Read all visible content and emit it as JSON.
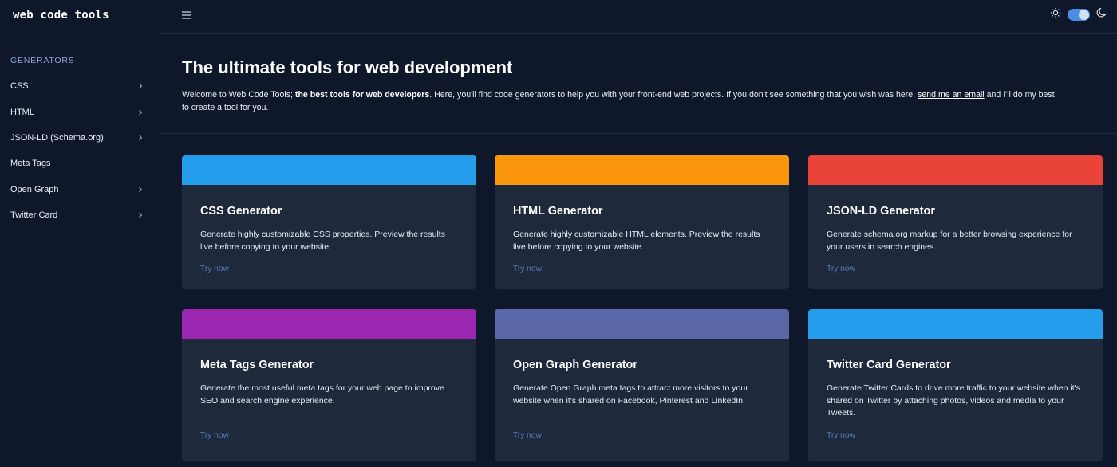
{
  "sidebar": {
    "logo": "web code tools",
    "heading": "Generators",
    "items": [
      {
        "label": "CSS",
        "has_chevron": true
      },
      {
        "label": "HTML",
        "has_chevron": true
      },
      {
        "label": "JSON-LD (Schema.org)",
        "has_chevron": true
      },
      {
        "label": "Meta Tags",
        "has_chevron": false
      },
      {
        "label": "Open Graph",
        "has_chevron": true
      },
      {
        "label": "Twitter Card",
        "has_chevron": true
      }
    ]
  },
  "topbar": {
    "menu_icon": "hamburger-icon",
    "sun_icon": "sun-icon",
    "moon_icon": "moon-icon",
    "dark_mode_on": true
  },
  "hero": {
    "title": "The ultimate tools for web development",
    "text_before_bold": "Welcome to Web Code Tools; ",
    "bold": "the best tools for web developers",
    "text_after_bold": ". Here, you'll find code generators to help you with your front-end web projects. If you don't see something that you wish was here, ",
    "link": "send me an email",
    "text_end": " and I'll do my best to create a tool for you."
  },
  "cards": [
    {
      "title": "CSS Generator",
      "desc": "Generate highly customizable CSS properties. Preview the results live before copying to your website.",
      "link": "Try now",
      "color": "#259ded"
    },
    {
      "title": "HTML Generator",
      "desc": "Generate highly customizable HTML elements. Preview the results live before copying to your website.",
      "link": "Try now",
      "color": "#fa970d"
    },
    {
      "title": "JSON-LD Generator",
      "desc": "Generate schema.org markup for a better browsing experience for your users in search engines.",
      "link": "Try now",
      "color": "#e9433a"
    },
    {
      "title": "Meta Tags Generator",
      "desc": "Generate the most useful meta tags for your web page to improve SEO and search engine experience.",
      "link": "Try now",
      "color": "#9b27b0"
    },
    {
      "title": "Open Graph Generator",
      "desc": "Generate Open Graph meta tags to attract more visitors to your website when it's shared on Facebook, Pinterest and LinkedIn.",
      "link": "Try now",
      "color": "#5a68a7"
    },
    {
      "title": "Twitter Card Generator",
      "desc": "Generate Twitter Cards to drive more traffic to your website when it's shared on Twitter by attaching photos, videos and media to your Tweets.",
      "link": "Try now",
      "color": "#259ded"
    }
  ]
}
